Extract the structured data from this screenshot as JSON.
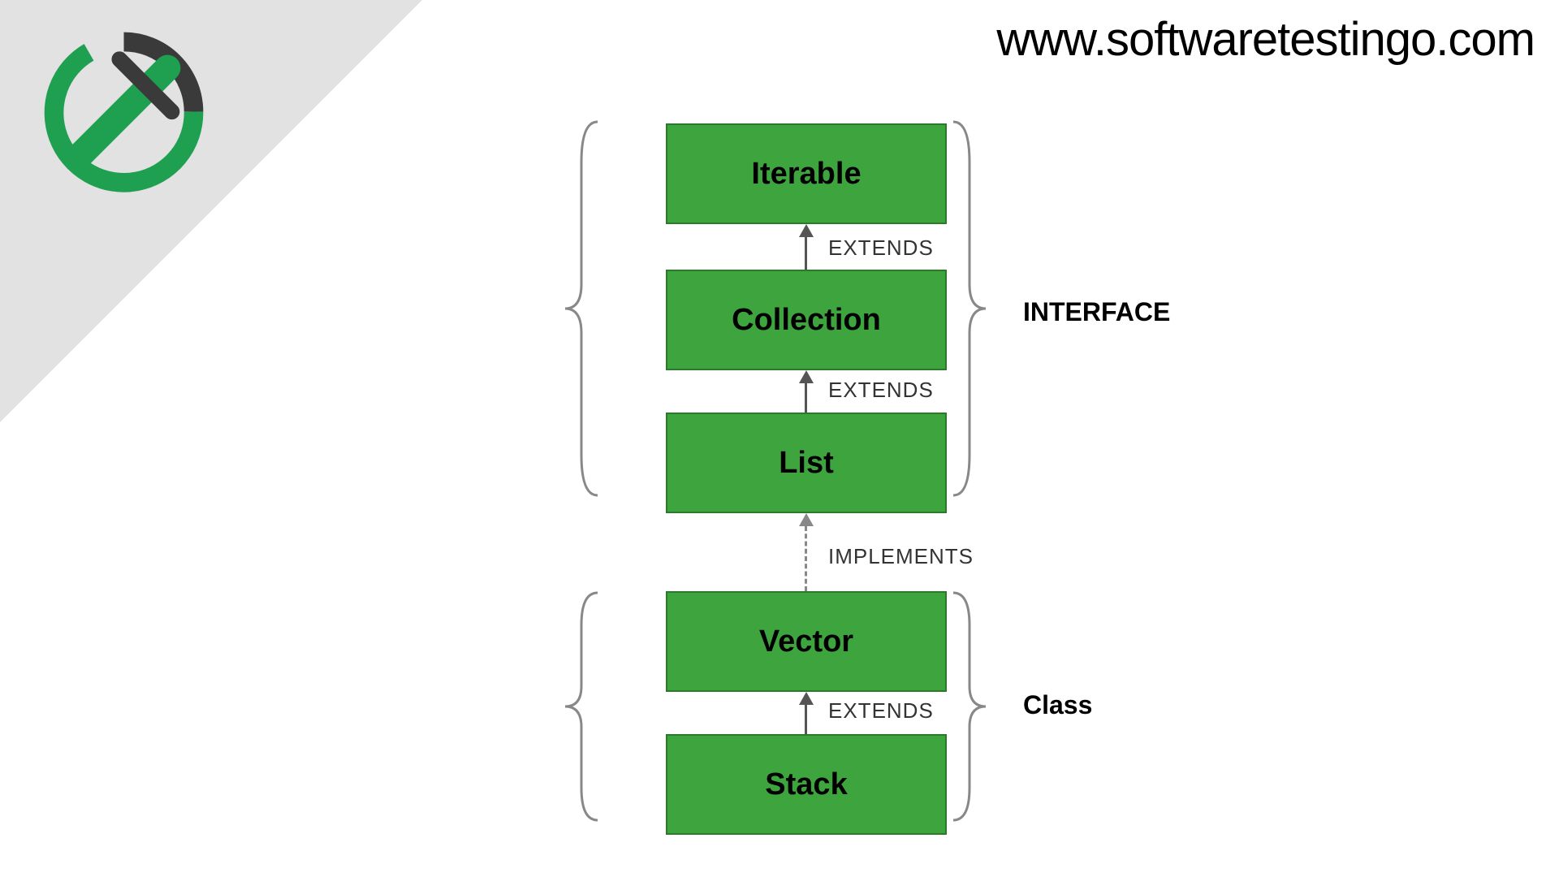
{
  "header": {
    "url": "www.softwaretestingo.com"
  },
  "nodes": {
    "iterable": "Iterable",
    "collection": "Collection",
    "list": "List",
    "vector": "Vector",
    "stack": "Stack"
  },
  "arrows": {
    "extends1": "EXTENDS",
    "extends2": "EXTENDS",
    "implements": "IMPLEMENTS",
    "extends3": "EXTENDS"
  },
  "groups": {
    "interface": "INTERFACE",
    "class": "Class"
  },
  "colors": {
    "node_bg": "#3ea53e",
    "node_border": "#2a7a2a",
    "triangle": "#e2e2e2",
    "logo_green": "#1fa050",
    "logo_dark": "#3a3a3a"
  }
}
